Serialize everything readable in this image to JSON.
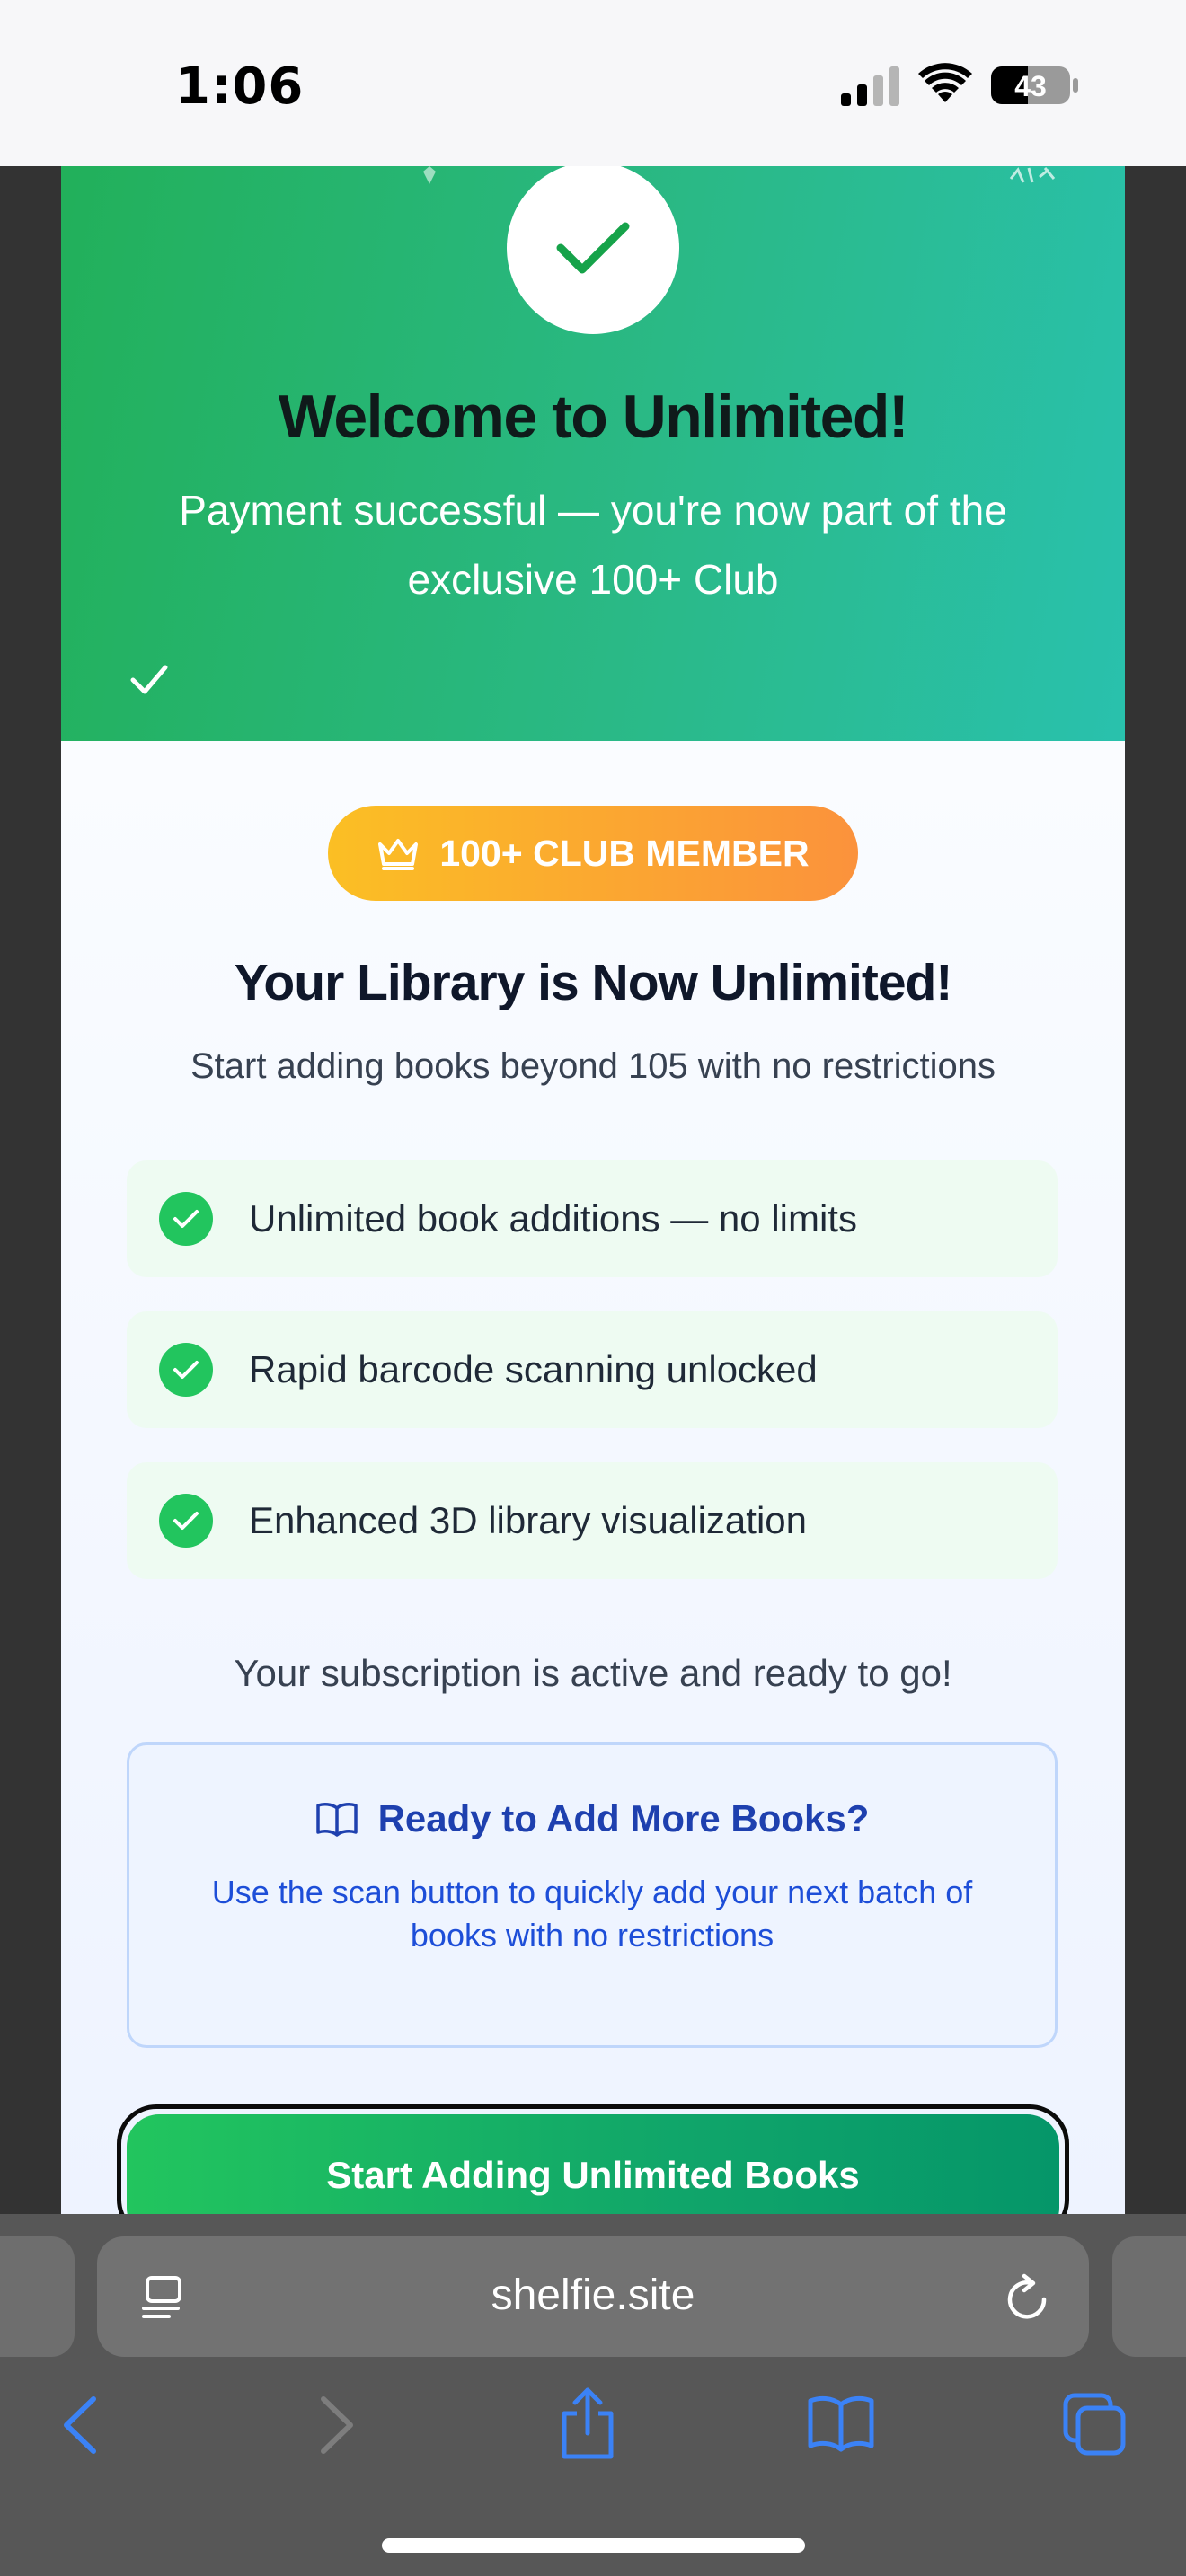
{
  "status_bar": {
    "time": "1:06",
    "battery_level": "43",
    "icons": [
      "signal-icon",
      "wifi-icon",
      "battery-icon"
    ]
  },
  "modal": {
    "header": {
      "title": "Welcome to Unlimited!",
      "subtitle": "Payment successful — you're now part of the exclusive 100+ Club",
      "icons": [
        "success-check-icon",
        "sparkle-icon"
      ]
    },
    "badge": {
      "label": "100+ CLUB MEMBER",
      "icon": "crown-icon"
    },
    "library": {
      "title": "Your Library is Now Unlimited!",
      "subtitle": "Start adding books beyond 105 with no restrictions"
    },
    "features": [
      {
        "label": "Unlimited book additions — no limits",
        "icon": "check-circle-icon"
      },
      {
        "label": "Rapid barcode scanning unlocked",
        "icon": "check-circle-icon"
      },
      {
        "label": "Enhanced 3D library visualization",
        "icon": "check-circle-icon"
      }
    ],
    "active_note": "Your subscription is active and ready to go!",
    "info_box": {
      "title": "Ready to Add More Books?",
      "body": "Use the scan button to quickly add your next batch of books with no restrictions",
      "icon": "open-book-icon"
    },
    "cta_label": "Start Adding Unlimited Books"
  },
  "browser": {
    "url": "shelfie.site",
    "icons": [
      "reader-icon",
      "reload-icon",
      "back-icon",
      "forward-icon",
      "share-icon",
      "bookmarks-icon",
      "tabs-icon"
    ]
  },
  "colors": {
    "header_gradient_start": "#22b05a",
    "header_gradient_end": "#29c1ad",
    "badge_gradient_start": "#fbbf24",
    "badge_gradient_end": "#fb923c",
    "feature_check": "#22c55e",
    "info_text": "#1e40af",
    "cta_gradient_start": "#22c55e",
    "cta_gradient_end": "#059669",
    "browser_accent": "#3b82f6"
  }
}
